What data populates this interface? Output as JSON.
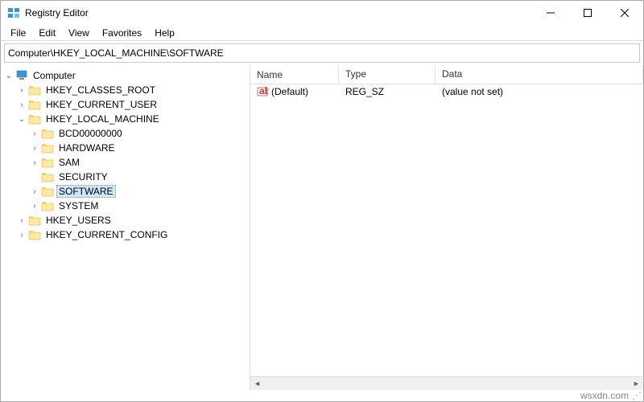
{
  "window": {
    "title": "Registry Editor"
  },
  "menu": {
    "file": "File",
    "edit": "Edit",
    "view": "View",
    "favorites": "Favorites",
    "help": "Help"
  },
  "address": {
    "path": "Computer\\HKEY_LOCAL_MACHINE\\SOFTWARE"
  },
  "tree": {
    "computer": "Computer",
    "hkcr": "HKEY_CLASSES_ROOT",
    "hkcu": "HKEY_CURRENT_USER",
    "hklm": "HKEY_LOCAL_MACHINE",
    "bcd": "BCD00000000",
    "hardware": "HARDWARE",
    "sam": "SAM",
    "security": "SECURITY",
    "software": "SOFTWARE",
    "system": "SYSTEM",
    "hku": "HKEY_USERS",
    "hkcc": "HKEY_CURRENT_CONFIG"
  },
  "list": {
    "headers": {
      "name": "Name",
      "type": "Type",
      "data": "Data"
    },
    "rows": [
      {
        "name": "(Default)",
        "type": "REG_SZ",
        "data": "(value not set)"
      }
    ]
  },
  "status": {
    "text": "wsxdn.com"
  }
}
